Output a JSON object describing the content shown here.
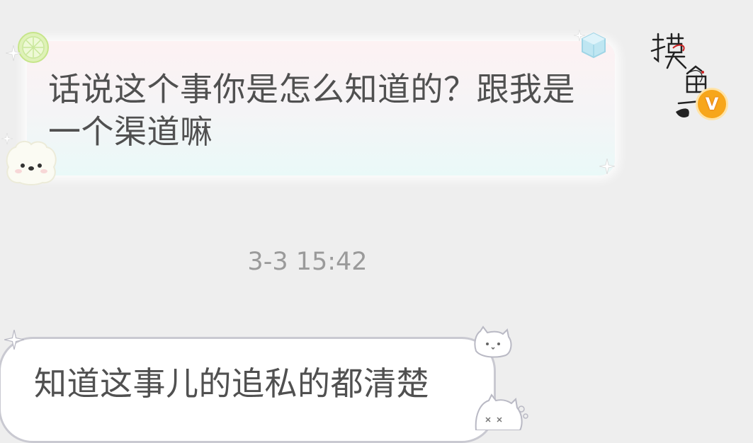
{
  "messages": [
    {
      "direction": "incoming",
      "text": "话说这个事你是怎么知道的？跟我是一个渠道嘛"
    },
    {
      "direction": "outgoing",
      "text": "知道这事儿的追私的都清楚"
    }
  ],
  "timestamp": "3-3 15:42",
  "avatar": {
    "logo_text": "摸鱼",
    "badge": "V",
    "badge_color": "#f7a61b"
  },
  "bubble_decorations": [
    "lemon-icon",
    "ice-cube-icon",
    "puppy-icon",
    "sparkle-icon",
    "cat-icon"
  ],
  "colors": {
    "background": "#eeeeee",
    "text": "#505050",
    "timestamp": "#9a9a9a"
  }
}
